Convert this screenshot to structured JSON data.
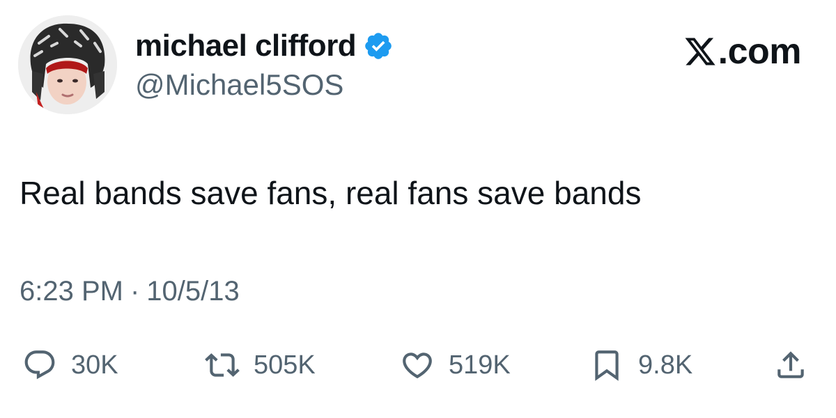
{
  "author": {
    "display_name": "michael clifford",
    "handle": "@Michael5SOS",
    "verified": true,
    "verified_color": "#1d9bf0"
  },
  "source": {
    "label": ".com",
    "icon": "x-logo-icon"
  },
  "tweet": {
    "text": "Real bands save fans, real fans save bands",
    "time": "6:23 PM",
    "separator": "·",
    "date": "10/5/13"
  },
  "actions": {
    "reply": {
      "icon": "reply-bubble-icon",
      "count": "30K"
    },
    "repost": {
      "icon": "repost-arrows-icon",
      "count": "505K"
    },
    "like": {
      "icon": "heart-icon",
      "count": "519K"
    },
    "bookmark": {
      "icon": "bookmark-icon",
      "count": "9.8K"
    },
    "share": {
      "icon": "share-upload-icon"
    }
  },
  "colors": {
    "text_primary": "#0f1419",
    "text_secondary": "#536471"
  }
}
